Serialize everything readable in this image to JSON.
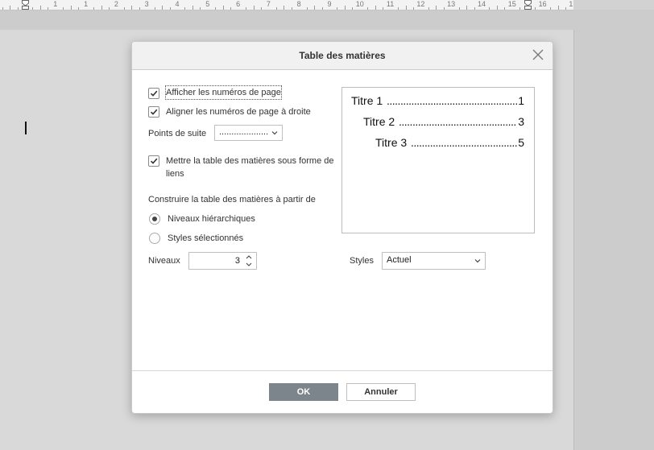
{
  "ruler": {
    "numbers": [
      "1",
      "2",
      "1",
      "1",
      "2",
      "3",
      "4",
      "5",
      "6",
      "7",
      "8",
      "9",
      "10",
      "11",
      "12",
      "13",
      "14",
      "15",
      "16",
      "17"
    ]
  },
  "dialog": {
    "title": "Table des matières",
    "show_page_numbers": {
      "label": "Afficher les numéros de page",
      "checked": true
    },
    "right_align_page_numbers": {
      "label": "Aligner les numéros de page à droite",
      "checked": true
    },
    "leader": {
      "label": "Points de suite",
      "value": "...................."
    },
    "as_links": {
      "label_line1": "Mettre la table des matières sous forme de",
      "label_line2": "liens",
      "checked": true
    },
    "build_from": {
      "label": "Construire la table des matières à partir de",
      "options": [
        {
          "label": "Niveaux hiérarchiques",
          "selected": true
        },
        {
          "label": "Styles sélectionnés",
          "selected": false
        }
      ]
    },
    "levels": {
      "label": "Niveaux",
      "value": "3"
    },
    "styles": {
      "label": "Styles",
      "value": "Actuel"
    },
    "preview": {
      "entries": [
        {
          "title": "Titre 1",
          "page": "1"
        },
        {
          "title": "Titre 2",
          "page": "3"
        },
        {
          "title": "Titre 3",
          "page": "5"
        }
      ]
    },
    "ok_label": "OK",
    "cancel_label": "Annuler"
  },
  "colors": {
    "ok_button": "#7d858c",
    "workspace": "#cccccc",
    "dialog_header": "#f1f1f1"
  },
  "icons": {
    "close": "close-icon",
    "checkbox": "checkmark-icon",
    "dropdown": "chevron-down-icon",
    "spinner": "spinner-arrows-icon"
  }
}
